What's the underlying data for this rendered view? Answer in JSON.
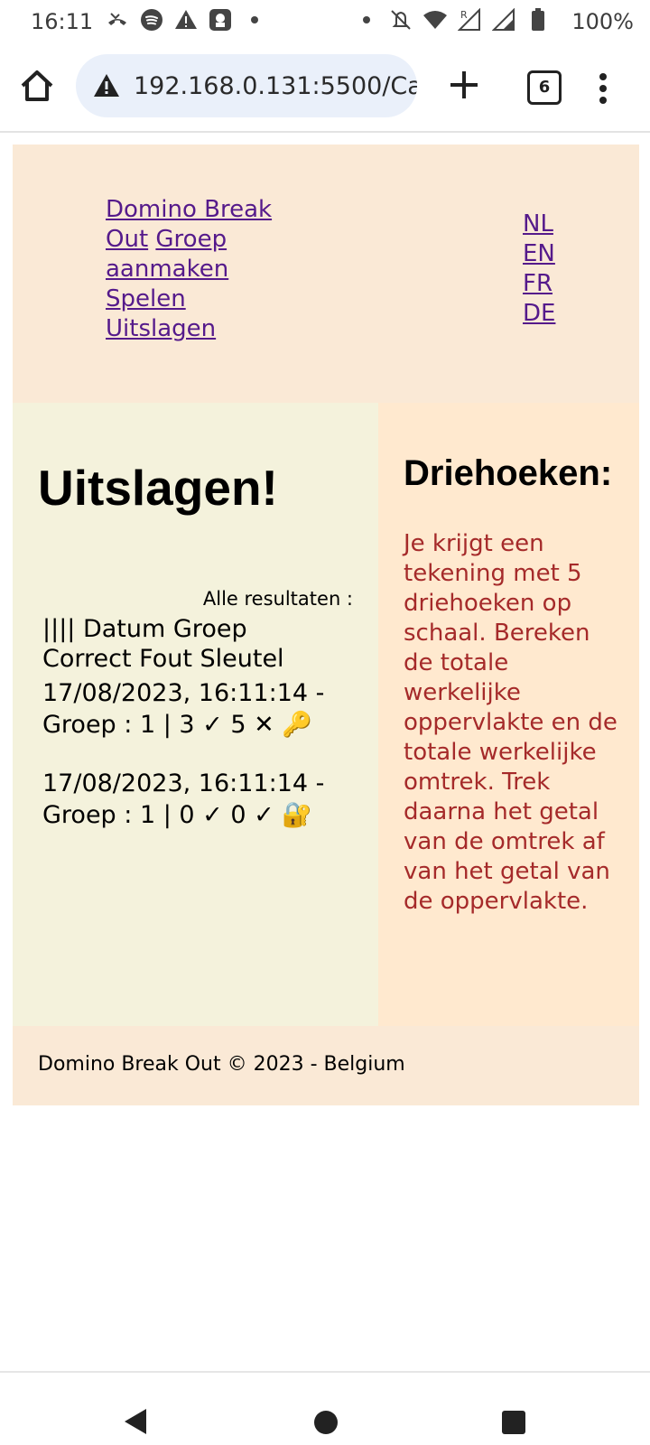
{
  "status_bar": {
    "time": "16:11",
    "battery": "100%",
    "left_icons": [
      "missed-call-icon",
      "spotify-icon",
      "warning-icon",
      "app-icon",
      "dot-icon"
    ],
    "right_icons": [
      "dot-icon",
      "mute-icon",
      "wifi-icon",
      "roaming-signal-icon",
      "signal-icon",
      "battery-icon"
    ]
  },
  "browser": {
    "url": "192.168.0.131:5500/Ca",
    "tab_count": "6"
  },
  "site": {
    "nav": {
      "home_link": "Domino Break Out",
      "create_group_link": "Groep aanmaken",
      "play_link": "Spelen",
      "results_link": "Uitslagen"
    },
    "languages": [
      "NL",
      "EN",
      "FR",
      "DE"
    ],
    "main": {
      "title": "Uitslagen!",
      "all_results_label": "Alle resultaten :",
      "table_header": "|||| Datum Groep Correct Fout Sleutel",
      "results": [
        {
          "line1": "17/08/2023, 16:11:14 -",
          "line2": "Groep : 1 | 3 ✓ 5 ✕ 🔑"
        },
        {
          "line1": "17/08/2023, 16:11:14 -",
          "line2": "Groep : 1 | 0 ✓ 0 ✓ 🔐"
        }
      ]
    },
    "aside": {
      "title": "Driehoeken:",
      "text": "Je krijgt een tekening met 5 driehoeken op schaal. Bereken de totale werkelijke oppervlakte en de totale werkelijke omtrek. Trek daarna het getal van de omtrek af van het getal van de oppervlakte."
    },
    "footer": "Domino Break Out © 2023 - Belgium"
  }
}
